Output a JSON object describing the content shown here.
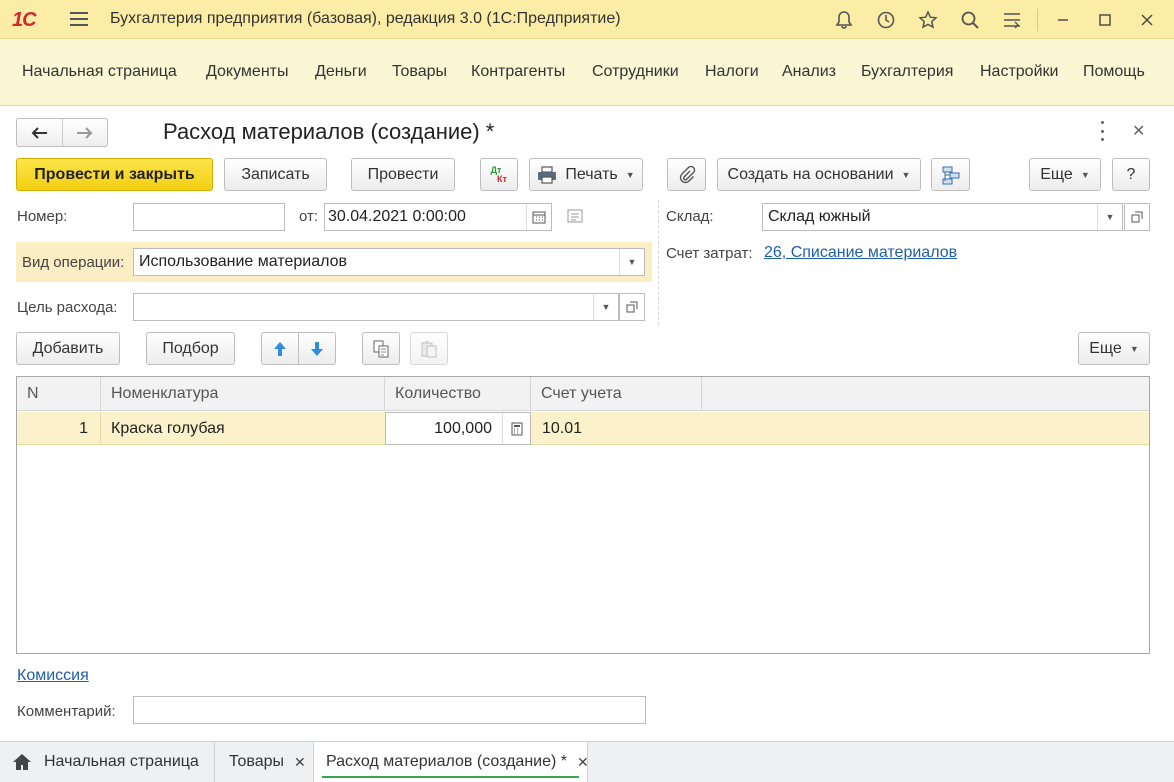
{
  "window": {
    "logo": "1С",
    "title": "Бухгалтерия предприятия (базовая), редакция 3.0  (1С:Предприятие)",
    "icons": [
      "bell-icon",
      "history-icon",
      "star-icon",
      "search-icon",
      "settings-icon",
      "minimize-icon",
      "maximize-icon",
      "close-icon"
    ]
  },
  "menu": {
    "items": [
      "Начальная страница",
      "Документы",
      "Деньги",
      "Товары",
      "Контрагенты",
      "Сотрудники",
      "Налоги",
      "Анализ",
      "Бухгалтерия",
      "Настройки",
      "Помощь"
    ]
  },
  "form": {
    "title": "Расход материалов (создание) *"
  },
  "toolbar": {
    "post_close": "Провести и закрыть",
    "write": "Записать",
    "post": "Провести",
    "dtkt_top": "Дт",
    "dtkt_bottom": "Кт",
    "print": "Печать",
    "create_based": "Создать на основании",
    "more": "Еще",
    "help": "?"
  },
  "fields": {
    "number_label": "Номер:",
    "number_value": "",
    "date_label": "от:",
    "date_value": "30.04.2021  0:00:00",
    "warehouse_label": "Склад:",
    "warehouse_value": "Склад южный",
    "operation_label": "Вид операции:",
    "operation_value": "Использование материалов",
    "cost_account_label": "Счет затрат:",
    "cost_account_value": "26, Списание материалов",
    "purpose_label": "Цель расхода:",
    "purpose_value": ""
  },
  "table_toolbar": {
    "add": "Добавить",
    "pick": "Подбор",
    "more": "Еще"
  },
  "table": {
    "columns": [
      "N",
      "Номенклатура",
      "Количество",
      "Счет учета"
    ],
    "rows": [
      {
        "n": "1",
        "item": "Краска голубая",
        "qty": "100,000",
        "account": "10.01"
      }
    ]
  },
  "footer": {
    "commission_link": "Комиссия",
    "comment_label": "Комментарий:",
    "comment_value": ""
  },
  "tabs": [
    {
      "label": "Начальная страница",
      "closable": false,
      "active": false
    },
    {
      "label": "Товары",
      "closable": true,
      "active": false
    },
    {
      "label": "Расход материалов (создание) *",
      "closable": true,
      "active": true
    }
  ],
  "colors": {
    "title_bar": "#fbeda6",
    "menu_bar": "#fbf6d4",
    "primary_button": "#f3cf12",
    "highlight_row": "#fbedc4",
    "link": "#1f5fa8",
    "active_tab_underline": "#3aa655"
  }
}
